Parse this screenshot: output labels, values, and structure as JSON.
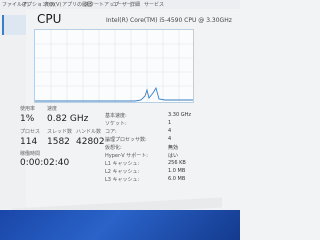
{
  "menu": [
    "ファイル(F)",
    "オプション(O)",
    "表示(V)",
    "アプリの履歴",
    "スタートアップ",
    "ユーザー",
    "詳細",
    "サービス"
  ],
  "cpu": {
    "title": "CPU",
    "model": "Intel(R) Core(TM) i5-4590 CPU @ 3.30GHz"
  },
  "stats": {
    "utilization_label": "使用率",
    "utilization_value": "1%",
    "speed_label": "速度",
    "speed_value": "0.82 GHz",
    "processes_label": "プロセス",
    "processes_value": "114",
    "threads_label": "スレッド数",
    "threads_value": "1582",
    "handles_label": "ハンドル数",
    "handles_value": "42802",
    "uptime_label": "稼働時間",
    "uptime_value": "0:00:02:40"
  },
  "details": [
    {
      "label": "基本速度:",
      "value": "3.30 GHz"
    },
    {
      "label": "ソケット:",
      "value": "1"
    },
    {
      "label": "コア:",
      "value": "4"
    },
    {
      "label": "論理プロセッサ数:",
      "value": "4"
    },
    {
      "label": "仮想化:",
      "value": "無効"
    },
    {
      "label": "Hyper-V サポート:",
      "value": "はい"
    },
    {
      "label": "L1 キャッシュ:",
      "value": "256 KB"
    },
    {
      "label": "L2 キャッシュ:",
      "value": "1.0 MB"
    },
    {
      "label": "L3 キャッシュ:",
      "value": "6.0 MB"
    }
  ],
  "colors": {
    "graph_line": "#3b7fc4",
    "graph_grid": "#dce8f3",
    "desktop": "#1f4fb4"
  }
}
